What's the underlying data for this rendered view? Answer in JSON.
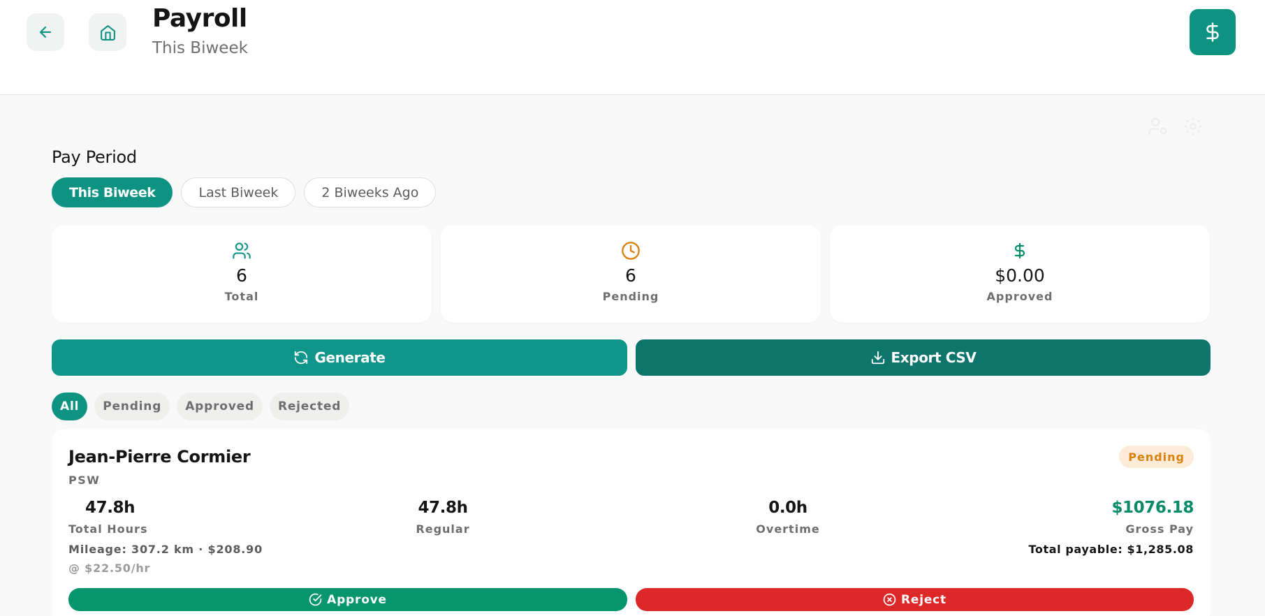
{
  "header": {
    "title": "Payroll",
    "subtitle": "This Biweek"
  },
  "colors": {
    "primary": "#0e9383",
    "primary_dark": "#0e756d",
    "approve": "#06956d",
    "reject": "#dc2828",
    "pending_text": "#d9820f",
    "pending_bg": "#fcebd6",
    "gross_pay": "#078a66"
  },
  "pay_period": {
    "label": "Pay Period",
    "options": [
      "This Biweek",
      "Last Biweek",
      "2 Biweeks Ago"
    ],
    "selected": "This Biweek"
  },
  "stats": [
    {
      "icon": "users-icon",
      "value": "6",
      "label": "Total"
    },
    {
      "icon": "clock-icon",
      "value": "6",
      "label": "Pending"
    },
    {
      "icon": "dollar-icon",
      "value": "$0.00",
      "label": "Approved"
    }
  ],
  "actions": {
    "generate_label": "Generate",
    "export_label": "Export CSV"
  },
  "status_filters": {
    "options": [
      "All",
      "Pending",
      "Approved",
      "Rejected"
    ],
    "selected": "All"
  },
  "employees": [
    {
      "name": "Jean-Pierre Cormier",
      "role": "PSW",
      "status": "Pending",
      "total_hours": "47.8h",
      "total_hours_label": "Total Hours",
      "regular": "47.8h",
      "regular_label": "Regular",
      "overtime": "0.0h",
      "overtime_label": "Overtime",
      "gross_pay": "$1076.18",
      "gross_pay_label": "Gross Pay",
      "mileage": "Mileage: 307.2 km · $208.90",
      "rate": "@ $22.50/hr",
      "total_payable": "Total payable: $1,285.08",
      "approve_label": "Approve",
      "reject_label": "Reject"
    }
  ]
}
